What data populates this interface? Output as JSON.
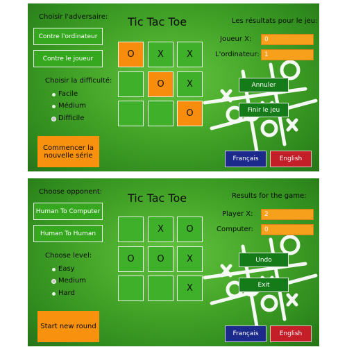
{
  "fr": {
    "opponent_heading": "Choisir l'adversaire:",
    "btn_vs_computer": "Contre l'ordinateur",
    "btn_vs_player": "Contre le joueur",
    "level_heading": "Choisir la difficulté:",
    "levels": [
      "Facile",
      "Médium",
      "Difficile"
    ],
    "selected_level": "Difficile",
    "start_button": "Commencer la nouvelle série",
    "title": "Tic Tac Toe",
    "board": [
      "O",
      "X",
      "X",
      "",
      "O",
      "X",
      "",
      "",
      "O"
    ],
    "results_heading": "Les résultats pour le jeu:",
    "player_label": "Joueur X:",
    "player_value": "0",
    "computer_label": "L'ordinateur:",
    "computer_value": "1",
    "cancel_button": "Annuler",
    "finish_button": "Finir le jeu",
    "lang_fr": "Français",
    "lang_en": "English"
  },
  "en": {
    "opponent_heading": "Choose opponent:",
    "btn_vs_computer": "Human To Computer",
    "btn_vs_player": "Human To Human",
    "level_heading": "Choose level:",
    "levels": [
      "Easy",
      "Medium",
      "Hard"
    ],
    "selected_level": "Medium",
    "start_button": "Start new round",
    "title": "Tic Tac Toe",
    "board": [
      "",
      "X",
      "O",
      "O",
      "O",
      "X",
      "",
      "",
      "X"
    ],
    "results_heading": "Results for the game:",
    "player_label": "Player X:",
    "player_value": "2",
    "computer_label": "Computer:",
    "computer_value": "0",
    "undo_button": "Undo",
    "exit_button": "Exit",
    "lang_fr": "Français",
    "lang_en": "English"
  },
  "colors": {
    "panel_green": "#43a428",
    "highlight_orange": "#f88c0c",
    "french_blue": "#1c2a8c",
    "english_red": "#c41e28"
  },
  "icons": [
    "tic-tac-toe-sketch-decoration-icon"
  ]
}
